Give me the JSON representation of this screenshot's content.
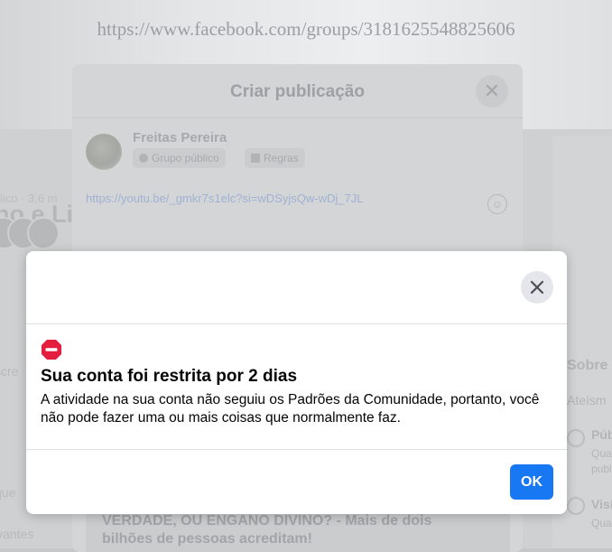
{
  "watermark": {
    "url": "https://www.facebook.com/groups/3181625548825606"
  },
  "background": {
    "group_title_fragment": "no e Li",
    "group_meta_fragment": "lico · 3,6 m",
    "left_fragments": [
      "scre",
      "que",
      "vantes"
    ],
    "right_panel": {
      "heading": "Sobre",
      "subheading": "Ateísm",
      "item1_title": "Púb",
      "item1_desc1": "Qua",
      "item1_desc2": "publ",
      "item2_title": "Visí",
      "item2_desc": "Qua"
    }
  },
  "create_post_dialog": {
    "title": "Criar publicação",
    "close_glyph": "✕",
    "author": "Freitas Pereira",
    "audience_chip": "Grupo público",
    "rules_chip": "Regras",
    "link_text": "https://youtu.be/_gmkr7s1elc?si=wDSyjsQw-wDj_7JL",
    "emoji_glyph": "☺",
    "preview_text": "VERDADE, OU ENGANO DIVINO? - Mais de dois bilhões de pessoas acreditam!"
  },
  "restriction_modal": {
    "title": "Sua conta foi restrita por 2 dias",
    "body": "A atividade na sua conta não seguiu os Padrões da Comunidade, portanto, você não pode fazer uma ou mais coisas que normalmente faz.",
    "ok_label": "OK",
    "stop_icon_color": "#e41e3f",
    "ok_color": "#1877f2"
  }
}
